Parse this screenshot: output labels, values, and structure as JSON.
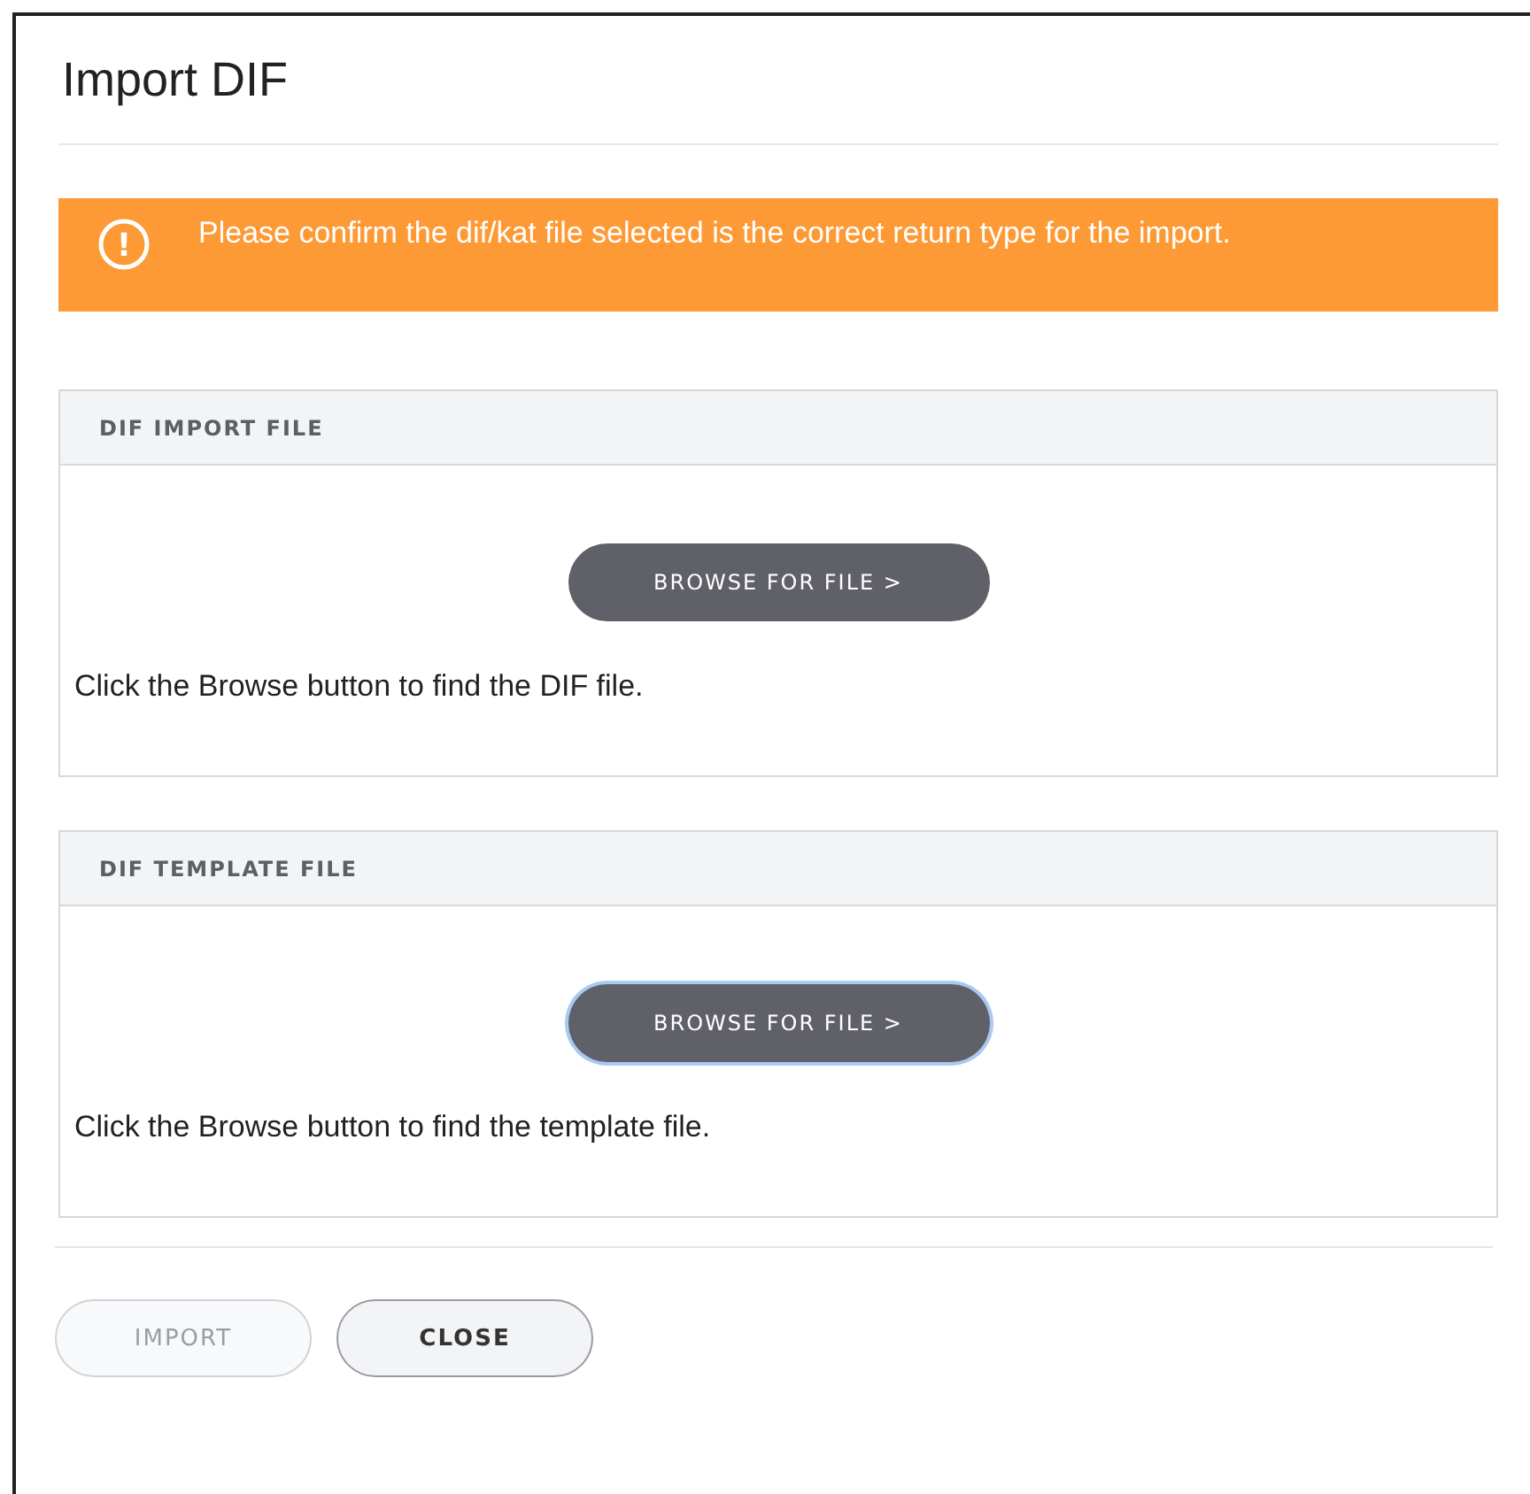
{
  "dialog": {
    "title": "Import DIF"
  },
  "alert": {
    "icon": "!",
    "message": "Please confirm the dif/kat file selected is the correct return type for the import."
  },
  "sections": [
    {
      "heading": "DIF IMPORT FILE",
      "button": {
        "label": "BROWSE FOR FILE >",
        "focused": false
      },
      "hint": "Click the Browse button to find the DIF file."
    },
    {
      "heading": "DIF TEMPLATE FILE",
      "button": {
        "label": "BROWSE FOR FILE >",
        "focused": true
      },
      "hint": "Click the Browse button to find the template file."
    }
  ],
  "buttons": [
    {
      "label": "IMPORT",
      "disabled": true
    },
    {
      "label": "CLOSE",
      "disabled": false
    }
  ]
}
